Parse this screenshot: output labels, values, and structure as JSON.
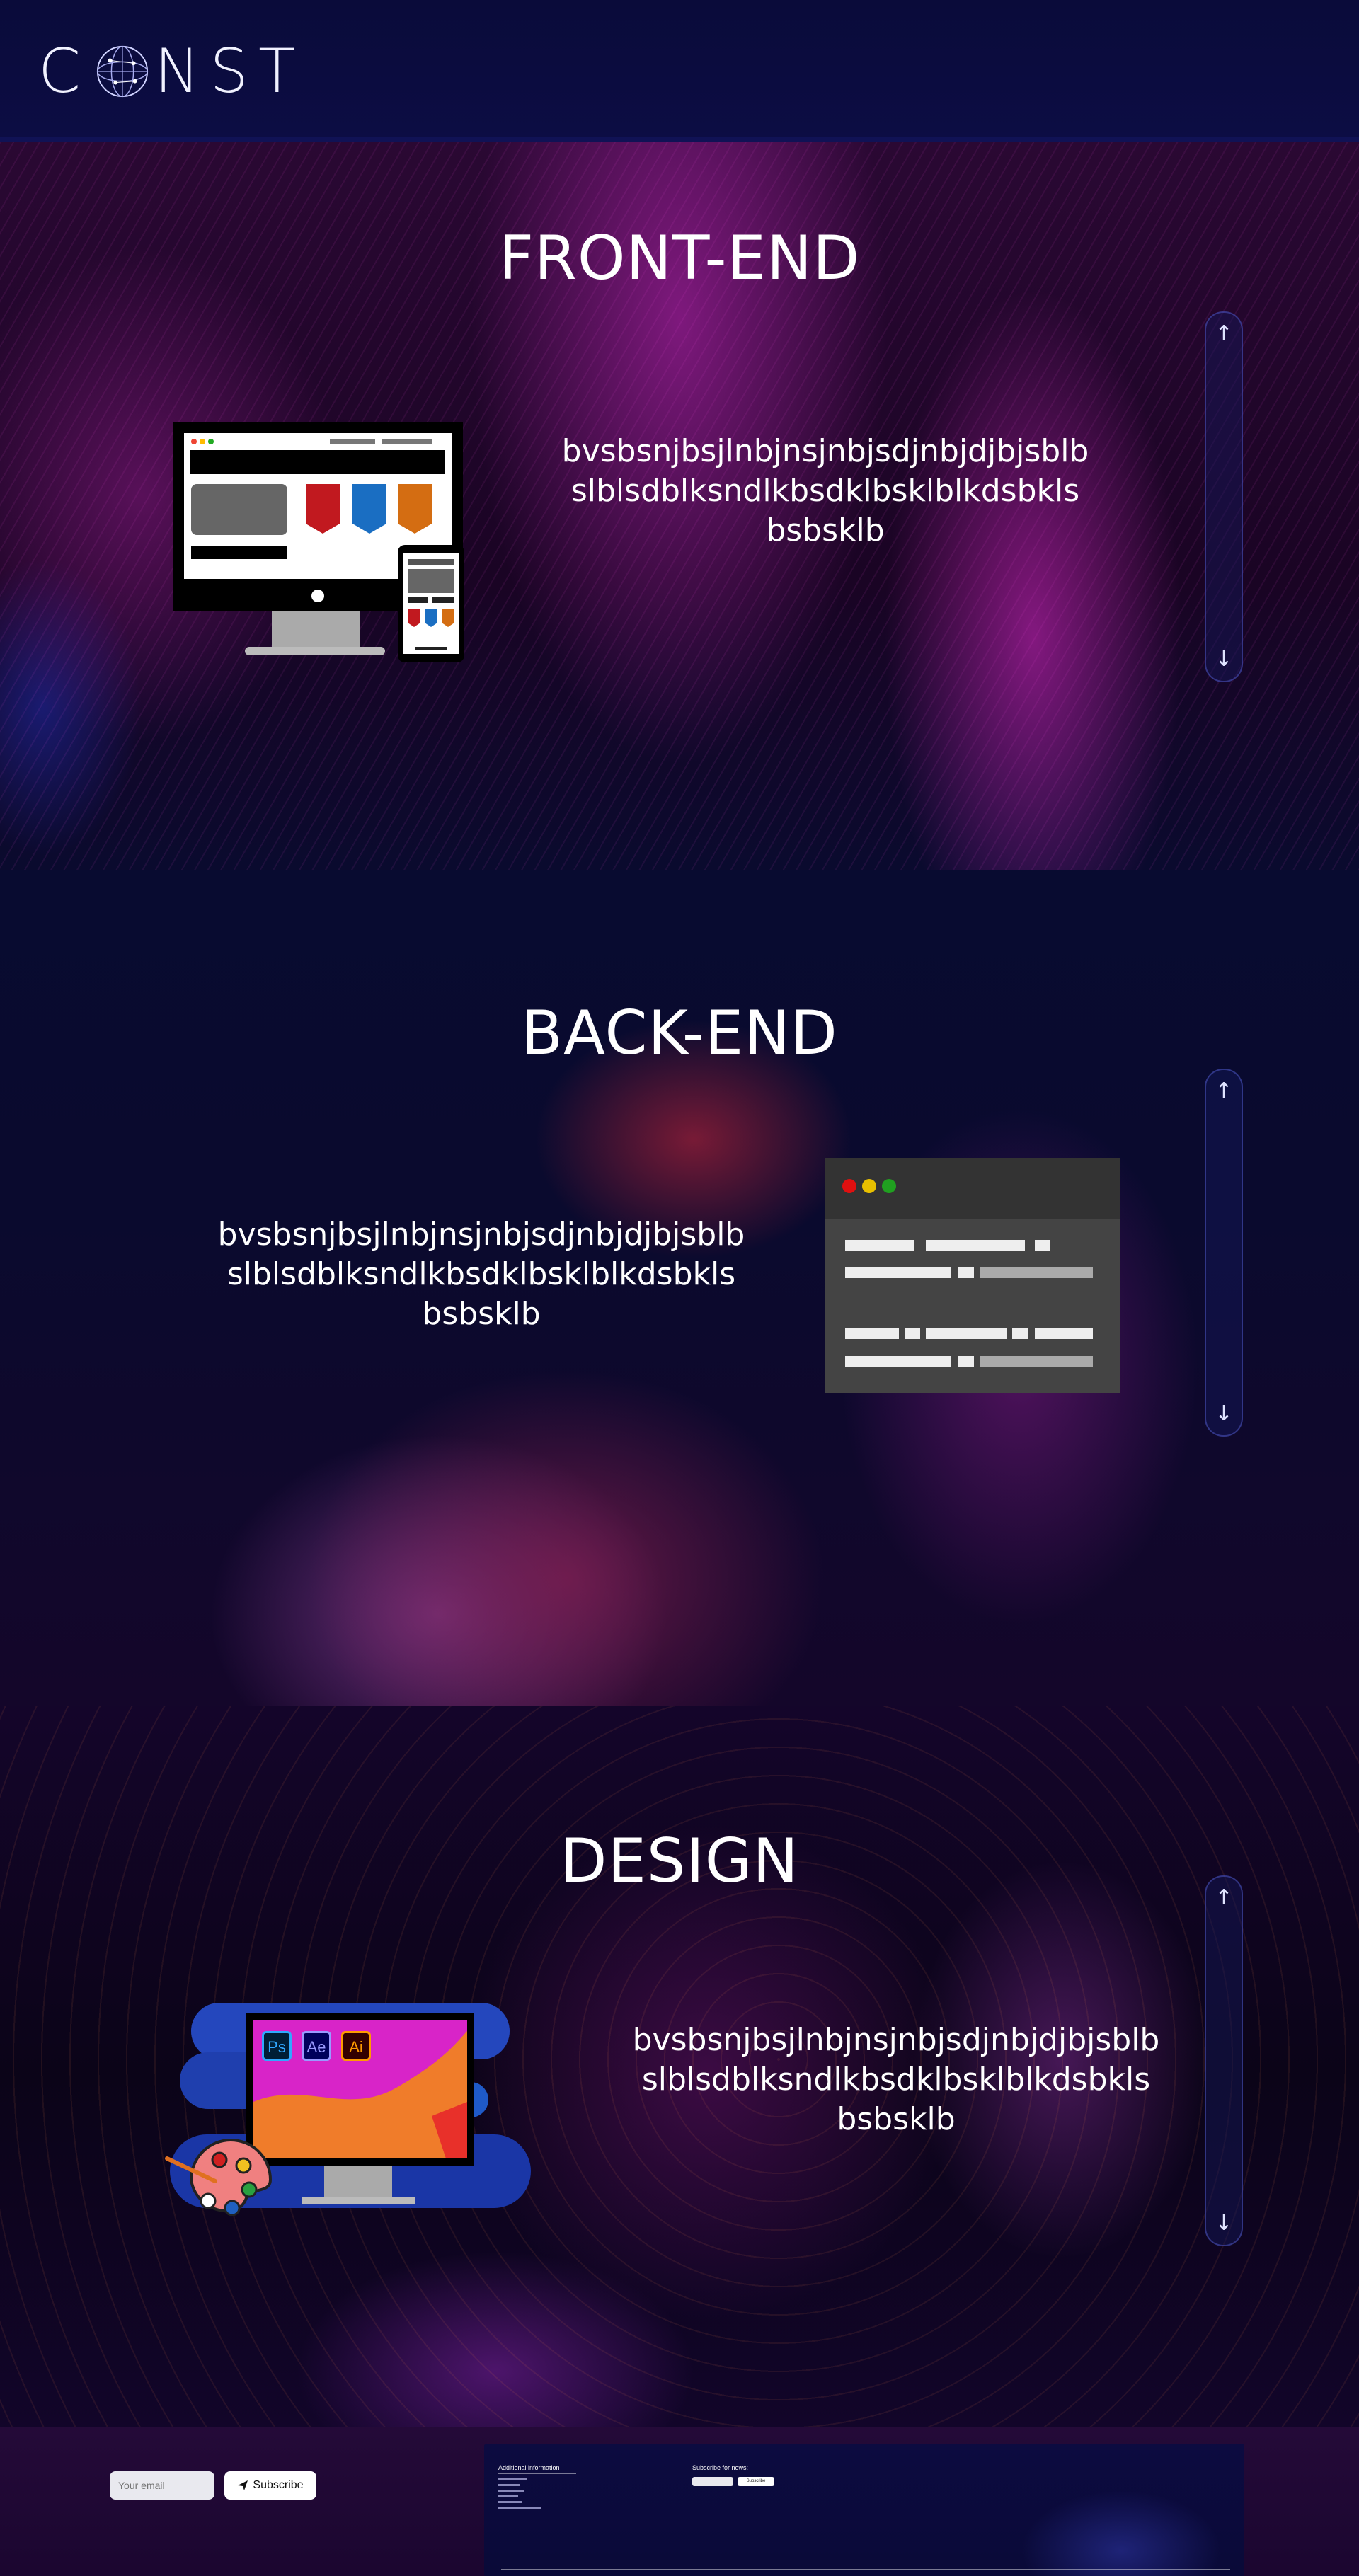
{
  "header": {
    "logo_text": "CONST"
  },
  "sections": [
    {
      "title": "FRONT-END",
      "text": "bvsbsnjbsjlnbjnsjnbjsdjnbjdjbjsblb slblsdblksndlkbsdklbsklblkdsbkls bsbsklb",
      "illustration": "responsive-devices-icon"
    },
    {
      "title": "BACK-END",
      "text": "bvsbsnjbsjlnbjnsjnbjsdjnbjdjbjsblb slblsdblksndlkbsdklbsklblkdsbkls bsbsklb",
      "illustration": "code-window-icon"
    },
    {
      "title": "DESIGN",
      "text": "bvsbsnjbsjlnbjnsjnbjsdjnbjdjbjsblb slblsdblksndlkbsdklbsklblkdsbkls bsbsklb",
      "illustration": "design-tools-icon",
      "app_badges": [
        "Ps",
        "Ae",
        "Ai"
      ]
    }
  ],
  "scroll_arrows": {
    "up": "↑",
    "down": "↓"
  },
  "footer": {
    "email_placeholder": "Your email",
    "subscribe_label": "Subscribe",
    "preview": {
      "info_title": "Additional information",
      "subscribe_title": "Subscribe for news:",
      "mini_placeholder": "Your email",
      "mini_button": "Subscribe"
    }
  },
  "colors": {
    "header_bg": "#0c0d44",
    "rail_border": "#5a64dc",
    "footer_bg": "#1b0630"
  }
}
